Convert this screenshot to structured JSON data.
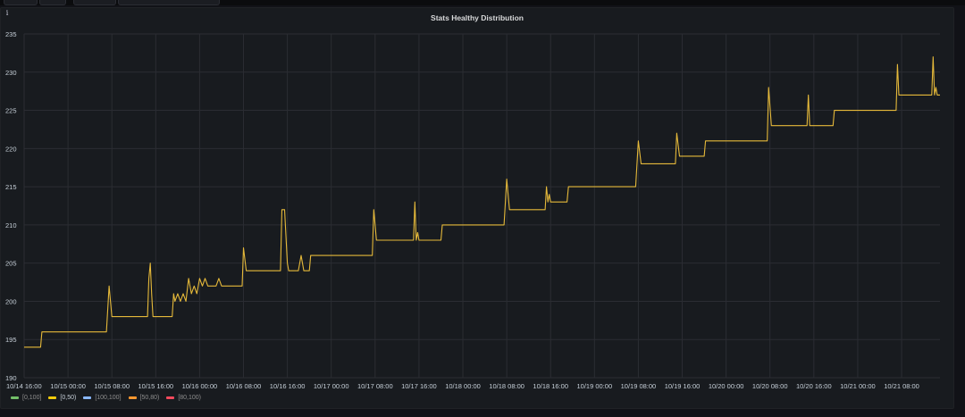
{
  "panel": {
    "title": "Stats Healthy Distribution",
    "info_glyph": "i"
  },
  "legend": [
    {
      "label": "[0,100]",
      "color": "#73bf69",
      "active": false
    },
    {
      "label": "[0,50)",
      "color": "#f2cc0c",
      "active": true
    },
    {
      "label": "[100,100]",
      "color": "#8ab8ff",
      "active": false
    },
    {
      "label": "[50,80)",
      "color": "#ff9830",
      "active": false
    },
    {
      "label": "[80,100)",
      "color": "#f2495c",
      "active": false
    }
  ],
  "chart_data": {
    "type": "line",
    "title": "Stats Healthy Distribution",
    "xlabel": "",
    "ylabel": "",
    "ylim": [
      190,
      235
    ],
    "yticks": [
      190,
      195,
      200,
      205,
      210,
      215,
      220,
      225,
      230,
      235
    ],
    "xlim": [
      "10/14 16:00",
      "10/21 15:00"
    ],
    "xticks": [
      "10/14 16:00",
      "10/15 00:00",
      "10/15 08:00",
      "10/15 16:00",
      "10/16 00:00",
      "10/16 08:00",
      "10/16 16:00",
      "10/17 00:00",
      "10/17 08:00",
      "10/17 16:00",
      "10/18 00:00",
      "10/18 08:00",
      "10/18 16:00",
      "10/19 00:00",
      "10/19 08:00",
      "10/19 16:00",
      "10/20 00:00",
      "10/20 08:00",
      "10/20 16:00",
      "10/21 00:00",
      "10/21 08:00"
    ],
    "grid": true,
    "legend_position": "bottom-left",
    "series": [
      {
        "name": "[0,50)",
        "color": "#e5b93a",
        "points": [
          [
            "10/14 16:00",
            194
          ],
          [
            "10/14 19:00",
            194
          ],
          [
            "10/14 19:15",
            196
          ],
          [
            "10/15 07:00",
            196
          ],
          [
            "10/15 07:30",
            202
          ],
          [
            "10/15 08:00",
            198
          ],
          [
            "10/15 14:30",
            198
          ],
          [
            "10/15 14:45",
            203
          ],
          [
            "10/15 15:00",
            205
          ],
          [
            "10/15 15:15",
            201
          ],
          [
            "10/15 15:30",
            198
          ],
          [
            "10/15 19:00",
            198
          ],
          [
            "10/15 19:15",
            201
          ],
          [
            "10/15 19:30",
            200
          ],
          [
            "10/15 20:00",
            201
          ],
          [
            "10/15 20:30",
            200
          ],
          [
            "10/15 21:00",
            201
          ],
          [
            "10/15 21:30",
            200
          ],
          [
            "10/15 22:00",
            203
          ],
          [
            "10/15 22:30",
            201
          ],
          [
            "10/15 23:00",
            202
          ],
          [
            "10/15 23:30",
            201
          ],
          [
            "10/16 00:00",
            203
          ],
          [
            "10/16 00:30",
            202
          ],
          [
            "10/16 01:00",
            203
          ],
          [
            "10/16 01:30",
            202
          ],
          [
            "10/16 03:00",
            202
          ],
          [
            "10/16 03:30",
            203
          ],
          [
            "10/16 04:00",
            202
          ],
          [
            "10/16 07:45",
            202
          ],
          [
            "10/16 08:00",
            207
          ],
          [
            "10/16 08:30",
            204
          ],
          [
            "10/16 14:45",
            204
          ],
          [
            "10/16 15:00",
            212
          ],
          [
            "10/16 15:30",
            212
          ],
          [
            "10/16 16:00",
            205
          ],
          [
            "10/16 16:15",
            204
          ],
          [
            "10/16 18:00",
            204
          ],
          [
            "10/16 18:30",
            206
          ],
          [
            "10/16 19:00",
            204
          ],
          [
            "10/16 20:00",
            204
          ],
          [
            "10/16 20:15",
            206
          ],
          [
            "10/17 07:30",
            206
          ],
          [
            "10/17 07:45",
            212
          ],
          [
            "10/17 08:15",
            208
          ],
          [
            "10/17 15:00",
            208
          ],
          [
            "10/17 15:15",
            213
          ],
          [
            "10/17 15:30",
            208
          ],
          [
            "10/17 15:45",
            209
          ],
          [
            "10/17 16:00",
            208
          ],
          [
            "10/17 20:00",
            208
          ],
          [
            "10/17 20:15",
            210
          ],
          [
            "10/18 07:30",
            210
          ],
          [
            "10/18 08:00",
            216
          ],
          [
            "10/18 08:30",
            212
          ],
          [
            "10/18 15:00",
            212
          ],
          [
            "10/18 15:15",
            215
          ],
          [
            "10/18 15:30",
            213
          ],
          [
            "10/18 15:45",
            214
          ],
          [
            "10/18 16:00",
            213
          ],
          [
            "10/18 19:00",
            213
          ],
          [
            "10/18 19:15",
            215
          ],
          [
            "10/19 07:30",
            215
          ],
          [
            "10/19 08:00",
            221
          ],
          [
            "10/19 08:30",
            218
          ],
          [
            "10/19 14:45",
            218
          ],
          [
            "10/19 15:00",
            222
          ],
          [
            "10/19 15:30",
            219
          ],
          [
            "10/19 20:00",
            219
          ],
          [
            "10/19 20:15",
            221
          ],
          [
            "10/20 07:30",
            221
          ],
          [
            "10/20 07:45",
            228
          ],
          [
            "10/20 08:15",
            223
          ],
          [
            "10/20 14:45",
            223
          ],
          [
            "10/20 15:00",
            227
          ],
          [
            "10/20 15:15",
            223
          ],
          [
            "10/20 19:30",
            223
          ],
          [
            "10/20 19:45",
            225
          ],
          [
            "10/21 07:00",
            225
          ],
          [
            "10/21 07:15",
            231
          ],
          [
            "10/21 07:30",
            227
          ],
          [
            "10/21 13:30",
            227
          ],
          [
            "10/21 13:45",
            232
          ],
          [
            "10/21 14:00",
            227
          ],
          [
            "10/21 14:15",
            228
          ],
          [
            "10/21 14:30",
            227
          ],
          [
            "10/21 15:00",
            227
          ]
        ]
      }
    ]
  }
}
